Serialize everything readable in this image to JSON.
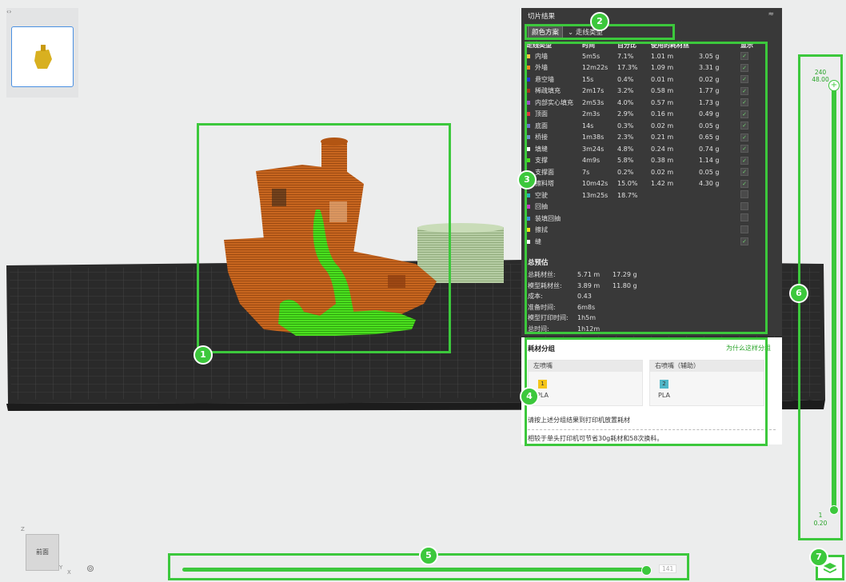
{
  "thumbnail": {
    "toggle_glyph": "‹›"
  },
  "slice_panel": {
    "title": "切片结果",
    "collapse_glyph": "≈",
    "scheme_label": "颜色方案",
    "scheme_value": "走线类型",
    "columns": {
      "type": "走线类型",
      "time": "时间",
      "percent": "百分比",
      "used": "使用的耗材丝",
      "show": "显示"
    },
    "rows": [
      {
        "name": "内墙",
        "color": "#f5c542",
        "time": "5m5s",
        "pct": "7.1%",
        "len": "1.01 m",
        "wt": "3.05 g",
        "checked": true
      },
      {
        "name": "外墙",
        "color": "#f08a1e",
        "time": "12m22s",
        "pct": "17.3%",
        "len": "1.09 m",
        "wt": "3.31 g",
        "checked": true
      },
      {
        "name": "悬空墙",
        "color": "#2136d6",
        "time": "15s",
        "pct": "0.4%",
        "len": "0.01 m",
        "wt": "0.02 g",
        "checked": true
      },
      {
        "name": "稀疏填充",
        "color": "#a0341c",
        "time": "2m17s",
        "pct": "3.2%",
        "len": "0.58 m",
        "wt": "1.77 g",
        "checked": true
      },
      {
        "name": "内部实心填充",
        "color": "#9a4fc2",
        "time": "2m53s",
        "pct": "4.0%",
        "len": "0.57 m",
        "wt": "1.73 g",
        "checked": true
      },
      {
        "name": "顶面",
        "color": "#e0363c",
        "time": "2m3s",
        "pct": "2.9%",
        "len": "0.16 m",
        "wt": "0.49 g",
        "checked": true
      },
      {
        "name": "底面",
        "color": "#6a74c9",
        "time": "14s",
        "pct": "0.3%",
        "len": "0.02 m",
        "wt": "0.05 g",
        "checked": true
      },
      {
        "name": "桥接",
        "color": "#6b8fc4",
        "time": "1m38s",
        "pct": "2.3%",
        "len": "0.21 m",
        "wt": "0.65 g",
        "checked": true
      },
      {
        "name": "填缝",
        "color": "#ffffff",
        "time": "3m24s",
        "pct": "4.8%",
        "len": "0.24 m",
        "wt": "0.74 g",
        "checked": true
      },
      {
        "name": "支撑",
        "color": "#4be01e",
        "time": "4m9s",
        "pct": "5.8%",
        "len": "0.38 m",
        "wt": "1.14 g",
        "checked": true
      },
      {
        "name": "支撑面",
        "color": "#2a7a1a",
        "time": "7s",
        "pct": "0.2%",
        "len": "0.02 m",
        "wt": "0.05 g",
        "checked": true
      },
      {
        "name": "擦料塔",
        "color": "#6d8fb8",
        "time": "10m42s",
        "pct": "15.0%",
        "len": "1.42 m",
        "wt": "4.30 g",
        "checked": true
      },
      {
        "name": "空驶",
        "color": "#2ab0b8",
        "time": "13m25s",
        "pct": "18.7%",
        "len": "",
        "wt": "",
        "checked": false
      },
      {
        "name": "回抽",
        "color": "#c33fc3",
        "time": "",
        "pct": "",
        "len": "",
        "wt": "",
        "checked": false
      },
      {
        "name": "装填回抽",
        "color": "#3a8fd6",
        "time": "",
        "pct": "",
        "len": "",
        "wt": "",
        "checked": false
      },
      {
        "name": "擦拭",
        "color": "#f2e21e",
        "time": "",
        "pct": "",
        "len": "",
        "wt": "",
        "checked": false
      },
      {
        "name": "缝",
        "color": "#ffffff",
        "time": "",
        "pct": "",
        "len": "",
        "wt": "",
        "checked": true
      }
    ],
    "summary_title": "总预估",
    "summary": [
      {
        "label": "总耗材丝:",
        "v1": "5.71 m",
        "v2": "17.29 g"
      },
      {
        "label": "模型耗材丝:",
        "v1": "3.89 m",
        "v2": "11.80 g"
      },
      {
        "label": "成本:",
        "v1": "0.43",
        "v2": ""
      },
      {
        "label": "准备时间:",
        "v1": "6m8s",
        "v2": ""
      },
      {
        "label": "模型打印时间:",
        "v1": "1h5m",
        "v2": ""
      },
      {
        "label": "总时间:",
        "v1": "1h12m",
        "v2": ""
      }
    ]
  },
  "filament_grouping": {
    "title": "耗材分组",
    "why_link": "为什么这样分组",
    "left_nozzle": "左喷嘴",
    "right_nozzle": "右喷嘴（辅助）",
    "left_slot": "1",
    "left_material": "PLA",
    "left_color": "#f5c518",
    "right_slot": "2",
    "right_material": "PLA",
    "right_color": "#4fb7c8",
    "note1": "请按上述分组结果到打印机放置耗材",
    "note2": "相较于单头打印机可节省30g耗材和58次换料。"
  },
  "layer_slider": {
    "top_layer": "240",
    "top_height": "48.00",
    "bottom_layer": "1",
    "bottom_height": "0.20"
  },
  "move_slider": {
    "value": "141"
  },
  "view_cube": {
    "face_label": "前面",
    "axis_z": "Z",
    "axis_y": "Y",
    "axis_x": "X"
  },
  "annotations": [
    {
      "id": "1",
      "target": "model"
    },
    {
      "id": "2",
      "target": "color-scheme"
    },
    {
      "id": "3",
      "target": "legend-table"
    },
    {
      "id": "4",
      "target": "filament-grouping"
    },
    {
      "id": "5",
      "target": "move-slider"
    },
    {
      "id": "6",
      "target": "layer-slider"
    },
    {
      "id": "7",
      "target": "layers-button"
    }
  ],
  "colors": {
    "accent": "#3cc83c",
    "panel_bg": "#393939",
    "model_orange": "#c8661f",
    "support_green": "#4be01e"
  }
}
